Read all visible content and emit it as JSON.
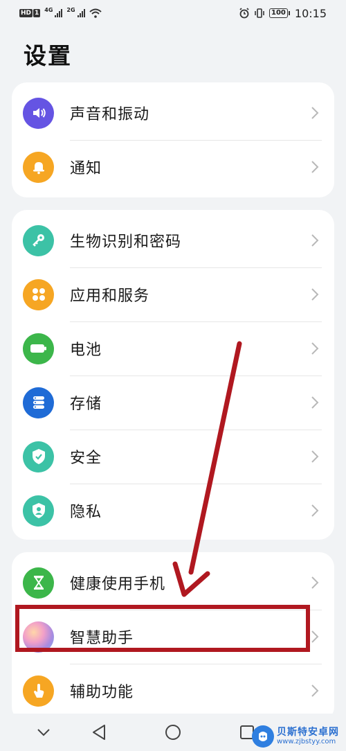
{
  "status_bar": {
    "hd_badge": "HD",
    "sim1_badge": "1",
    "net1": "4G",
    "net2": "2G",
    "battery": "100",
    "time": "10:15"
  },
  "page": {
    "title": "设置"
  },
  "groups": [
    {
      "items": [
        {
          "label": "声音和振动",
          "icon": "speaker-icon",
          "color": "#6554e3"
        },
        {
          "label": "通知",
          "icon": "bell-icon",
          "color": "#f6a623"
        }
      ]
    },
    {
      "items": [
        {
          "label": "生物识别和密码",
          "icon": "key-icon",
          "color": "#3cc2a6"
        },
        {
          "label": "应用和服务",
          "icon": "apps-grid-icon",
          "color": "#f6a623"
        },
        {
          "label": "电池",
          "icon": "battery-icon",
          "color": "#3cb64a"
        },
        {
          "label": "存储",
          "icon": "storage-icon",
          "color": "#1f6bd6"
        },
        {
          "label": "安全",
          "icon": "shield-check-icon",
          "color": "#3cc2a6"
        },
        {
          "label": "隐私",
          "icon": "privacy-shield-icon",
          "color": "#3cc2a6"
        }
      ]
    },
    {
      "items": [
        {
          "label": "健康使用手机",
          "icon": "hourglass-icon",
          "color": "#3cb64a"
        },
        {
          "label": "智慧助手",
          "icon": "assistant-orb-icon",
          "color": "#c98bd8"
        },
        {
          "label": "辅助功能",
          "icon": "hand-pointer-icon",
          "color": "#f6a623"
        }
      ]
    }
  ],
  "annotation": {
    "color": "#b01820"
  },
  "watermark": {
    "name": "贝斯特安卓网",
    "url": "www.zjbstyy.com"
  }
}
